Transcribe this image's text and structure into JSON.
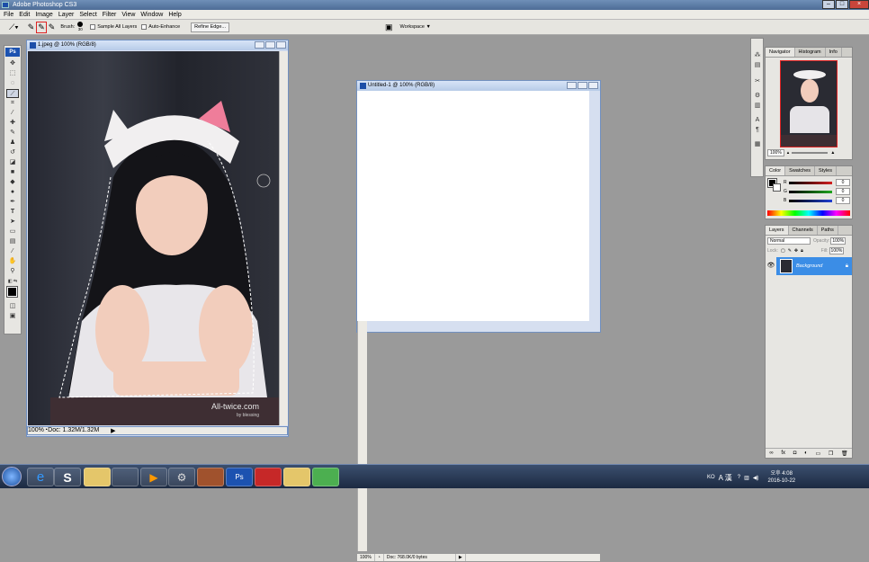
{
  "app": {
    "title": "Adobe Photoshop CS3"
  },
  "menu": [
    "File",
    "Edit",
    "Image",
    "Layer",
    "Select",
    "Filter",
    "View",
    "Window",
    "Help"
  ],
  "options": {
    "brush_label": "Brush:",
    "brush_size": "30",
    "sample_all_layers": "Sample All Layers",
    "auto_enhance": "Auto-Enhance",
    "refine_edge": "Refine Edge...",
    "workspace": "Workspace ▼"
  },
  "doc1": {
    "title": "1.jpeg @ 100% (RGB/8)",
    "zoom": "100%",
    "doc_info": "Doc: 1.32M/1.32M",
    "watermark": "All-twice.com",
    "watermark_sub": "by blessing"
  },
  "doc2": {
    "title": "Untitled-1 @ 100% (RGB/8)",
    "zoom": "100%",
    "doc_info": "Doc: 768.0K/0 bytes"
  },
  "navigator": {
    "tabs": [
      "Navigator",
      "Histogram",
      "Info"
    ],
    "zoom": "100%"
  },
  "color_panel": {
    "tabs": [
      "Color",
      "Swatches",
      "Styles"
    ],
    "channels": [
      {
        "label": "R",
        "value": "0",
        "color": "#d31f1f"
      },
      {
        "label": "G",
        "value": "0",
        "color": "#1fa51f"
      },
      {
        "label": "B",
        "value": "0",
        "color": "#1f3fd3"
      }
    ]
  },
  "layers_panel": {
    "tabs": [
      "Layers",
      "Channels",
      "Paths"
    ],
    "blend_mode": "Normal",
    "opacity_label": "Opacity:",
    "opacity": "100%",
    "lock_label": "Lock:",
    "fill_label": "Fill:",
    "fill": "100%",
    "layer_name": "Background"
  },
  "tray": {
    "lang": "KO",
    "ime": "A 漢",
    "time": "오후 4:08",
    "date": "2016-10-22"
  },
  "colors": {
    "accent": "#1c52b0",
    "selection": "#3b8de6"
  }
}
